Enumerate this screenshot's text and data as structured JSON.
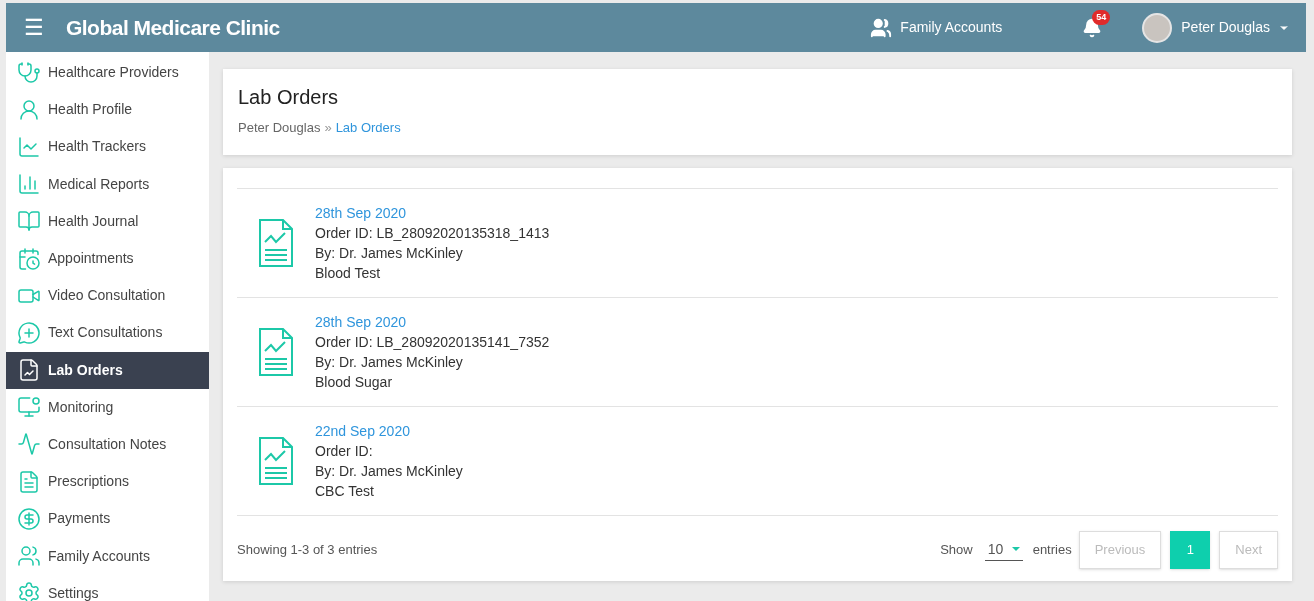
{
  "header": {
    "menu_icon": "☰",
    "title": "Global Medicare Clinic",
    "family_link": "Family Accounts",
    "notifications": "54",
    "user": "Peter Douglas"
  },
  "sidebar": {
    "items": [
      {
        "label": "Healthcare Providers",
        "kind": "doctor",
        "selected": false
      },
      {
        "label": "Health Profile",
        "kind": "user",
        "selected": false
      },
      {
        "label": "Health Trackers",
        "kind": "chart",
        "selected": false
      },
      {
        "label": "Medical Reports",
        "kind": "bars",
        "selected": false
      },
      {
        "label": "Health Journal",
        "kind": "book",
        "selected": false
      },
      {
        "label": "Appointments",
        "kind": "calendar",
        "selected": false
      },
      {
        "label": "Video Consultation",
        "kind": "video",
        "selected": false
      },
      {
        "label": "Text Consultations",
        "kind": "chat",
        "selected": false
      },
      {
        "label": "Lab Orders",
        "kind": "report",
        "selected": true
      },
      {
        "label": "Monitoring",
        "kind": "monitor",
        "selected": false
      },
      {
        "label": "Consultation Notes",
        "kind": "stethoscope",
        "selected": false
      },
      {
        "label": "Prescriptions",
        "kind": "rx",
        "selected": false
      },
      {
        "label": "Payments",
        "kind": "payment",
        "selected": false
      },
      {
        "label": "Family Accounts",
        "kind": "family",
        "selected": false
      },
      {
        "label": "Settings",
        "kind": "settings",
        "selected": false
      }
    ]
  },
  "page": {
    "title": "Lab Orders",
    "breadcrumb": [
      {
        "label": "Peter Douglas",
        "selected": false
      },
      {
        "label": "Lab Orders",
        "selected": true
      }
    ],
    "separator": "»"
  },
  "orders": [
    {
      "date": "28th Sep 2020",
      "order_id": "Order ID: LB_28092020135318_1413",
      "by": "By: Dr. James McKinley",
      "test": "Blood Test"
    },
    {
      "date": "28th Sep 2020",
      "order_id": "Order ID: LB_28092020135141_7352",
      "by": "By: Dr. James McKinley",
      "test": "Blood Sugar"
    },
    {
      "date": "22nd Sep 2020",
      "order_id": "Order ID:",
      "by": "By: Dr. James McKinley",
      "test": "CBC Test"
    }
  ],
  "footer": {
    "summary": "Showing 1-3 of 3 entries",
    "show_label": "Show",
    "page_size": "10",
    "entries_label": "entries",
    "pages": [
      {
        "label": "Previous",
        "kind": "nav",
        "disabled": true,
        "selected": false
      },
      {
        "label": "1",
        "kind": "page",
        "disabled": false,
        "selected": true
      },
      {
        "label": "Next",
        "kind": "nav",
        "disabled": true,
        "selected": false
      }
    ]
  }
}
